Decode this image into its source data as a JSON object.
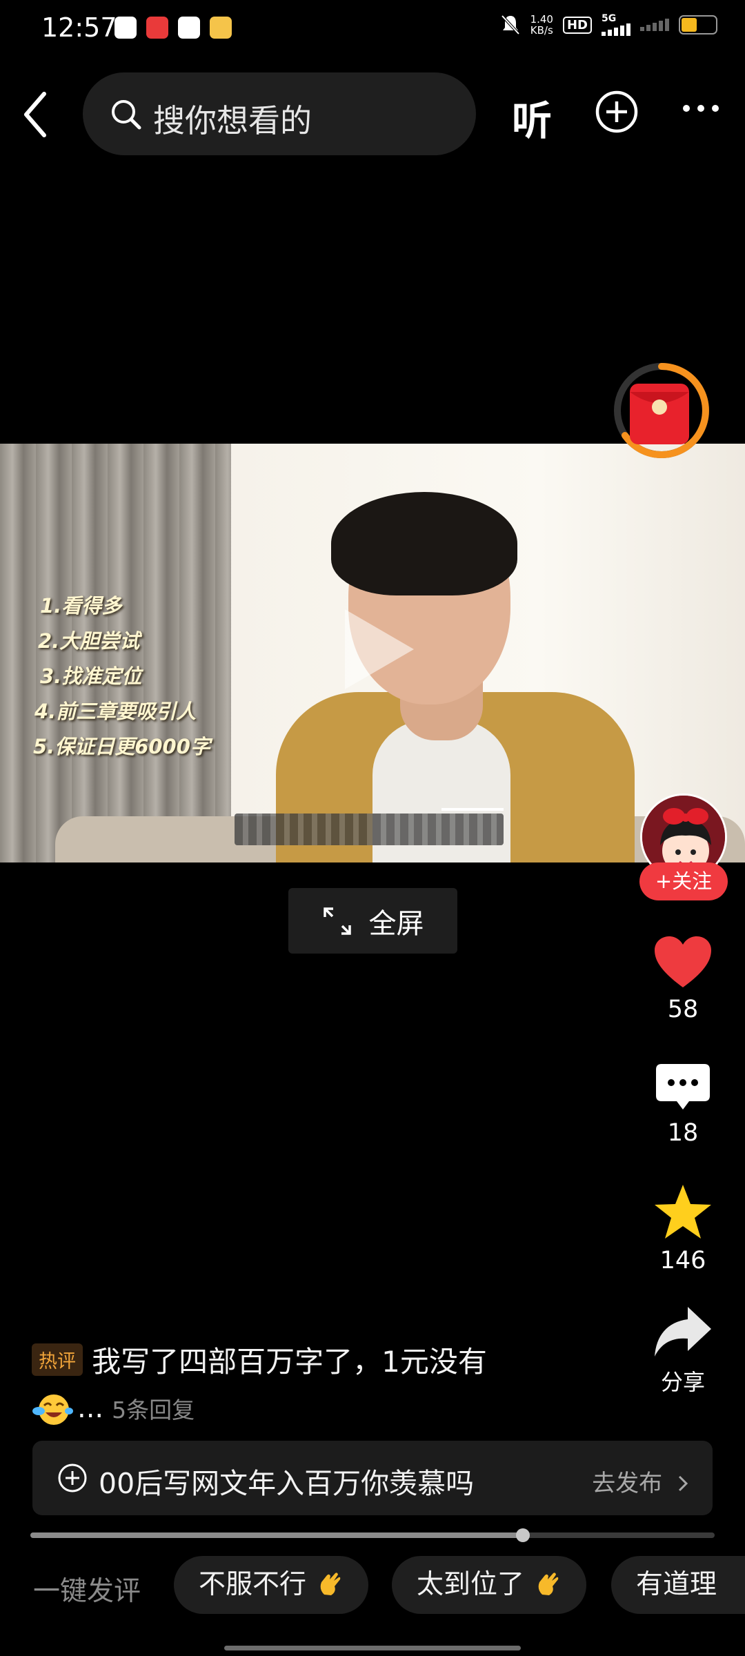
{
  "status_bar": {
    "time": "12:57",
    "net_speed": "1.40",
    "net_unit": "KB/s",
    "hd_label": "HD",
    "network": "5G",
    "battery_level": 0.45
  },
  "nav": {
    "search_placeholder": "搜你想看的",
    "listen_label": "听"
  },
  "video": {
    "overlay_list": [
      "1.看得多",
      "2.大胆尝试",
      "3.找准定位",
      "4.前三章要吸引人",
      "5.保证日更6000字"
    ]
  },
  "fullscreen_label": "全屏",
  "author": {
    "follow_label": "+关注"
  },
  "actions": {
    "likes": "58",
    "comments": "18",
    "favorites": "146",
    "share_label": "分享"
  },
  "hot_comment": {
    "tag": "热评",
    "text": "我写了四部百万字了，1元没有",
    "ellipsis": "...",
    "replies": "5条回复"
  },
  "topic": {
    "text": "00后写网文年入百万你羡慕吗",
    "action": "去发布"
  },
  "progress": {
    "played_fraction": 0.72
  },
  "quick_comment": {
    "label": "一键发评",
    "chips": [
      "不服不行",
      "太到位了",
      "有道理"
    ]
  },
  "colors": {
    "accent_red": "#f03a40",
    "like_red": "#ee3b3f",
    "star_yellow": "#ffcf1d",
    "hot_tag": "#f0a43a"
  }
}
